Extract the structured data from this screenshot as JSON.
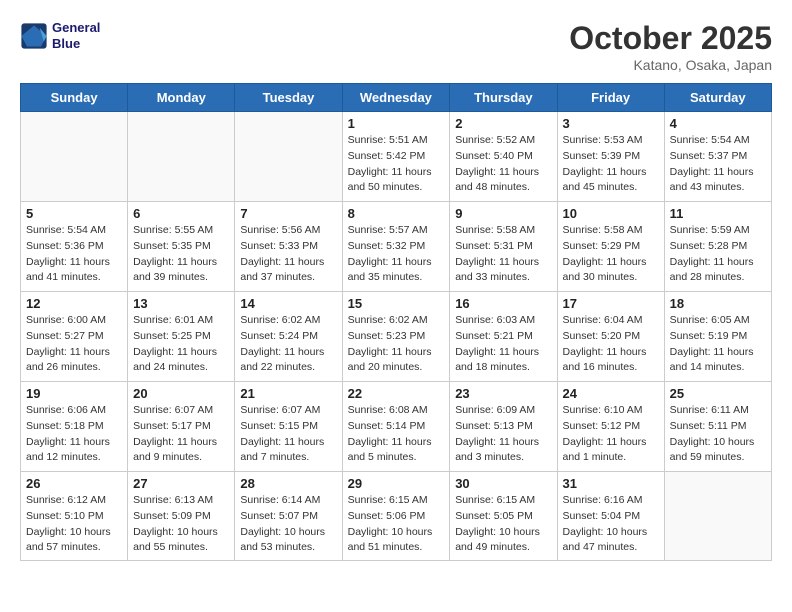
{
  "header": {
    "logo_line1": "General",
    "logo_line2": "Blue",
    "month": "October 2025",
    "location": "Katano, Osaka, Japan"
  },
  "weekdays": [
    "Sunday",
    "Monday",
    "Tuesday",
    "Wednesday",
    "Thursday",
    "Friday",
    "Saturday"
  ],
  "weeks": [
    [
      {
        "day": "",
        "info": ""
      },
      {
        "day": "",
        "info": ""
      },
      {
        "day": "",
        "info": ""
      },
      {
        "day": "1",
        "info": "Sunrise: 5:51 AM\nSunset: 5:42 PM\nDaylight: 11 hours\nand 50 minutes."
      },
      {
        "day": "2",
        "info": "Sunrise: 5:52 AM\nSunset: 5:40 PM\nDaylight: 11 hours\nand 48 minutes."
      },
      {
        "day": "3",
        "info": "Sunrise: 5:53 AM\nSunset: 5:39 PM\nDaylight: 11 hours\nand 45 minutes."
      },
      {
        "day": "4",
        "info": "Sunrise: 5:54 AM\nSunset: 5:37 PM\nDaylight: 11 hours\nand 43 minutes."
      }
    ],
    [
      {
        "day": "5",
        "info": "Sunrise: 5:54 AM\nSunset: 5:36 PM\nDaylight: 11 hours\nand 41 minutes."
      },
      {
        "day": "6",
        "info": "Sunrise: 5:55 AM\nSunset: 5:35 PM\nDaylight: 11 hours\nand 39 minutes."
      },
      {
        "day": "7",
        "info": "Sunrise: 5:56 AM\nSunset: 5:33 PM\nDaylight: 11 hours\nand 37 minutes."
      },
      {
        "day": "8",
        "info": "Sunrise: 5:57 AM\nSunset: 5:32 PM\nDaylight: 11 hours\nand 35 minutes."
      },
      {
        "day": "9",
        "info": "Sunrise: 5:58 AM\nSunset: 5:31 PM\nDaylight: 11 hours\nand 33 minutes."
      },
      {
        "day": "10",
        "info": "Sunrise: 5:58 AM\nSunset: 5:29 PM\nDaylight: 11 hours\nand 30 minutes."
      },
      {
        "day": "11",
        "info": "Sunrise: 5:59 AM\nSunset: 5:28 PM\nDaylight: 11 hours\nand 28 minutes."
      }
    ],
    [
      {
        "day": "12",
        "info": "Sunrise: 6:00 AM\nSunset: 5:27 PM\nDaylight: 11 hours\nand 26 minutes."
      },
      {
        "day": "13",
        "info": "Sunrise: 6:01 AM\nSunset: 5:25 PM\nDaylight: 11 hours\nand 24 minutes."
      },
      {
        "day": "14",
        "info": "Sunrise: 6:02 AM\nSunset: 5:24 PM\nDaylight: 11 hours\nand 22 minutes."
      },
      {
        "day": "15",
        "info": "Sunrise: 6:02 AM\nSunset: 5:23 PM\nDaylight: 11 hours\nand 20 minutes."
      },
      {
        "day": "16",
        "info": "Sunrise: 6:03 AM\nSunset: 5:21 PM\nDaylight: 11 hours\nand 18 minutes."
      },
      {
        "day": "17",
        "info": "Sunrise: 6:04 AM\nSunset: 5:20 PM\nDaylight: 11 hours\nand 16 minutes."
      },
      {
        "day": "18",
        "info": "Sunrise: 6:05 AM\nSunset: 5:19 PM\nDaylight: 11 hours\nand 14 minutes."
      }
    ],
    [
      {
        "day": "19",
        "info": "Sunrise: 6:06 AM\nSunset: 5:18 PM\nDaylight: 11 hours\nand 12 minutes."
      },
      {
        "day": "20",
        "info": "Sunrise: 6:07 AM\nSunset: 5:17 PM\nDaylight: 11 hours\nand 9 minutes."
      },
      {
        "day": "21",
        "info": "Sunrise: 6:07 AM\nSunset: 5:15 PM\nDaylight: 11 hours\nand 7 minutes."
      },
      {
        "day": "22",
        "info": "Sunrise: 6:08 AM\nSunset: 5:14 PM\nDaylight: 11 hours\nand 5 minutes."
      },
      {
        "day": "23",
        "info": "Sunrise: 6:09 AM\nSunset: 5:13 PM\nDaylight: 11 hours\nand 3 minutes."
      },
      {
        "day": "24",
        "info": "Sunrise: 6:10 AM\nSunset: 5:12 PM\nDaylight: 11 hours\nand 1 minute."
      },
      {
        "day": "25",
        "info": "Sunrise: 6:11 AM\nSunset: 5:11 PM\nDaylight: 10 hours\nand 59 minutes."
      }
    ],
    [
      {
        "day": "26",
        "info": "Sunrise: 6:12 AM\nSunset: 5:10 PM\nDaylight: 10 hours\nand 57 minutes."
      },
      {
        "day": "27",
        "info": "Sunrise: 6:13 AM\nSunset: 5:09 PM\nDaylight: 10 hours\nand 55 minutes."
      },
      {
        "day": "28",
        "info": "Sunrise: 6:14 AM\nSunset: 5:07 PM\nDaylight: 10 hours\nand 53 minutes."
      },
      {
        "day": "29",
        "info": "Sunrise: 6:15 AM\nSunset: 5:06 PM\nDaylight: 10 hours\nand 51 minutes."
      },
      {
        "day": "30",
        "info": "Sunrise: 6:15 AM\nSunset: 5:05 PM\nDaylight: 10 hours\nand 49 minutes."
      },
      {
        "day": "31",
        "info": "Sunrise: 6:16 AM\nSunset: 5:04 PM\nDaylight: 10 hours\nand 47 minutes."
      },
      {
        "day": "",
        "info": ""
      }
    ]
  ]
}
